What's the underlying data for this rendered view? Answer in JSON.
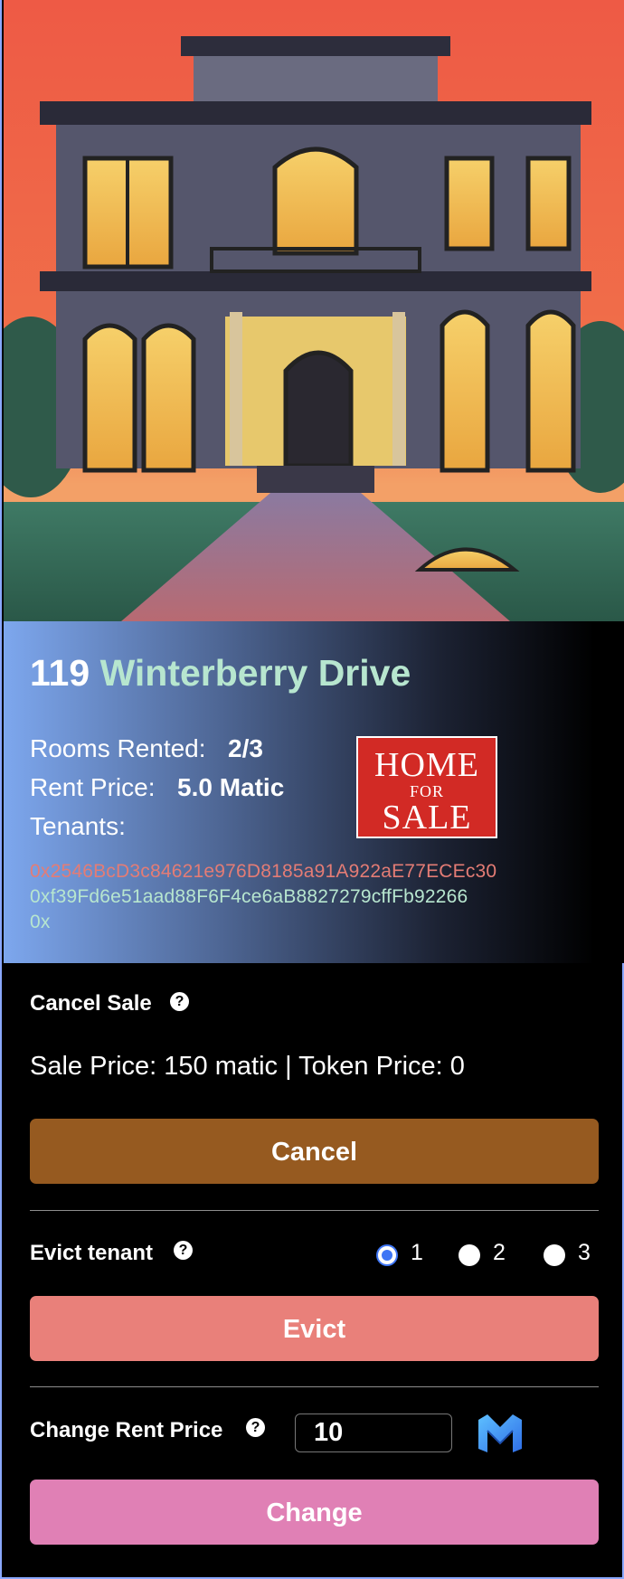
{
  "listing": {
    "number": "119",
    "street": "Winterberry Drive",
    "rooms_label": "Rooms Rented:",
    "rooms_value": "2/3",
    "rent_label": "Rent Price:",
    "rent_value": "5.0 Matic",
    "tenants_label": "Tenants:",
    "tenants": [
      {
        "address": "0x2546BcD3c84621e976D8185a91A922aE77ECEc30",
        "color": "#e47c75"
      },
      {
        "address": "0xf39Fd6e51aad88F6F4ce6aB8827279cffFb92266",
        "color": "#b7e6cf"
      },
      {
        "address": "0x",
        "color": "#b7e6cf"
      }
    ],
    "badge": {
      "line1": "HOME",
      "line2": "FOR",
      "line3": "SALE"
    }
  },
  "cancel_sale": {
    "title": "Cancel Sale",
    "help": "?",
    "info": "Sale Price: 150 matic | Token Price: 0",
    "button": "Cancel",
    "button_color": "#965a20"
  },
  "evict": {
    "title": "Evict tenant",
    "help": "?",
    "options": [
      "1",
      "2",
      "3"
    ],
    "selected": "1",
    "button": "Evict",
    "button_color": "#e9807a"
  },
  "change_rent": {
    "title": "Change Rent Price",
    "help": "?",
    "input_value": "10",
    "token_icon": "polygon-matic-icon",
    "button": "Change",
    "button_color": "#e080b5"
  },
  "colors": {
    "accent_street": "#b7e6cf",
    "radio_selected": "#3f76f5"
  }
}
